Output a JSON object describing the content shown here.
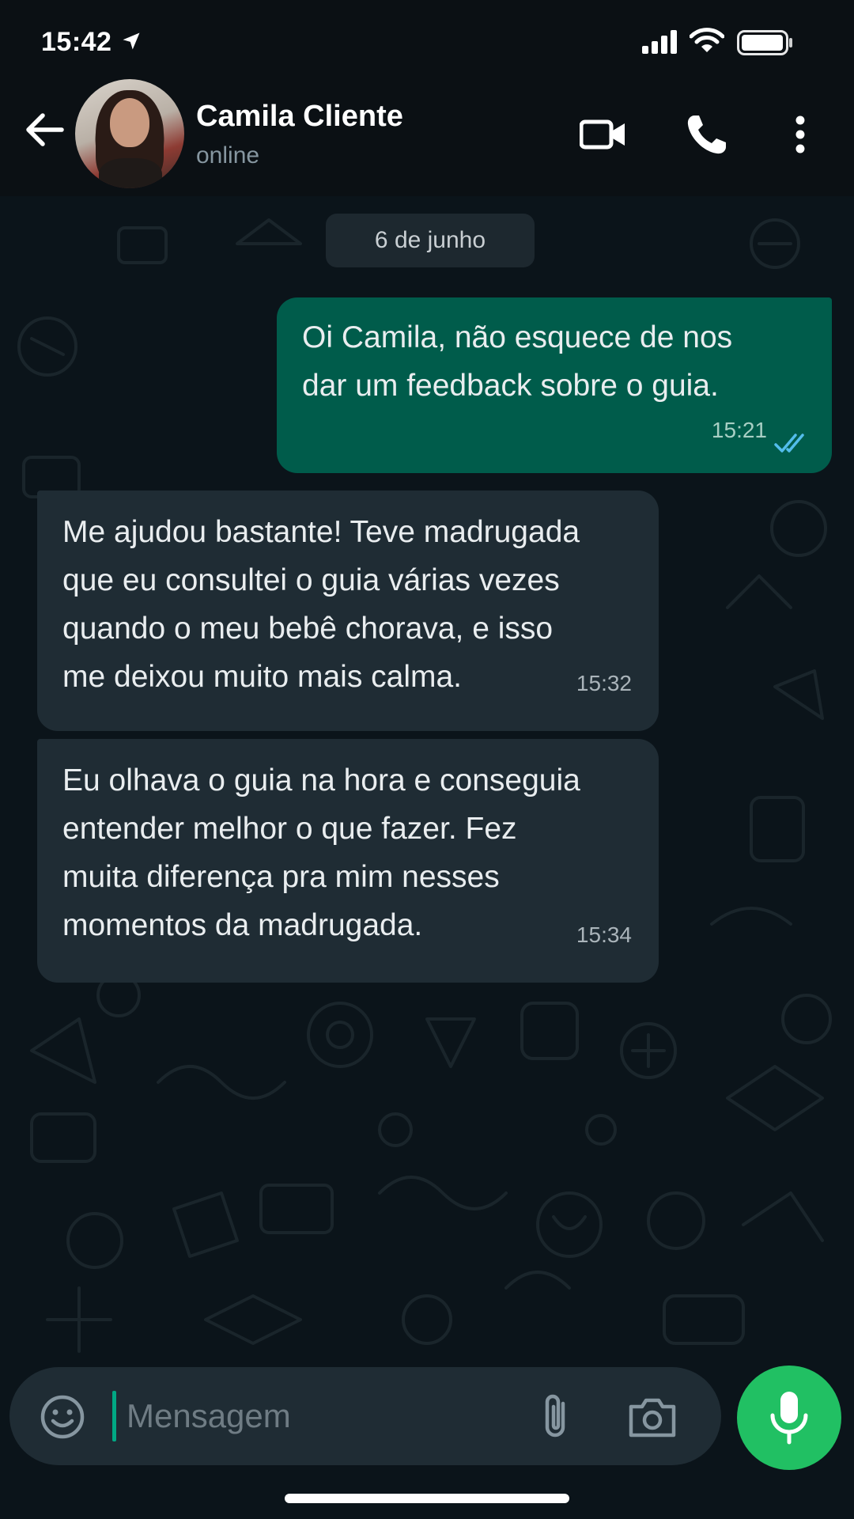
{
  "status_bar": {
    "time": "15:42"
  },
  "header": {
    "contact_name": "Camila Cliente",
    "contact_status": "online",
    "icons": [
      "back-arrow-icon",
      "video-camera-icon",
      "phone-icon",
      "more-vertical-icon"
    ]
  },
  "chat": {
    "date_label": "6 de junho",
    "messages": [
      {
        "direction": "outgoing",
        "text": "Oi Camila, não esquece de nos\ndar um feedback sobre o guia.",
        "time": "15:21",
        "status": "read"
      },
      {
        "direction": "incoming",
        "text": "Me ajudou bastante! Teve madrugada\nque eu consultei o guia várias vezes\nquando o meu bebê chorava, e isso\nme deixou muito mais calma.",
        "time": "15:32"
      },
      {
        "direction": "incoming",
        "text": "Eu olhava o guia na hora e conseguia\nentender melhor o que fazer. Fez\nmuita diferença pra mim nesses\nmomentos da madrugada.",
        "time": "15:34"
      }
    ]
  },
  "composer": {
    "value": "",
    "placeholder": "Mensagem",
    "icons": [
      "emoji-icon",
      "paperclip-icon",
      "camera-icon",
      "microphone-icon"
    ]
  },
  "colors": {
    "background": "#0b141a",
    "outgoing_bubble": "#005c4b",
    "incoming_bubble": "#1f2c34",
    "accent": "#21c063",
    "read_ticks": "#53bdeb"
  }
}
